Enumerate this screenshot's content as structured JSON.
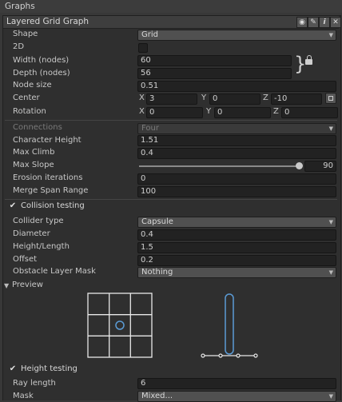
{
  "window": {
    "title": "Graphs"
  },
  "graph": {
    "title": "Layered Grid Graph"
  },
  "fields": {
    "shape": {
      "label": "Shape",
      "value": "Grid"
    },
    "twod": {
      "label": "2D"
    },
    "width": {
      "label": "Width (nodes)",
      "value": "60"
    },
    "depth": {
      "label": "Depth (nodes)",
      "value": "56"
    },
    "node_size": {
      "label": "Node size",
      "value": "0.51"
    },
    "center": {
      "label": "Center",
      "x": "3",
      "y": "0",
      "z": "-10"
    },
    "rotation": {
      "label": "Rotation",
      "x": "0",
      "y": "0",
      "z": "0"
    },
    "connections": {
      "label": "Connections",
      "value": "Four"
    },
    "char_height": {
      "label": "Character Height",
      "value": "1.51"
    },
    "max_climb": {
      "label": "Max Climb",
      "value": "0.4"
    },
    "max_slope": {
      "label": "Max Slope",
      "value": "90",
      "slider_fraction": 1.0
    },
    "erosion": {
      "label": "Erosion iterations",
      "value": "0"
    },
    "merge_span": {
      "label": "Merge Span Range",
      "value": "100"
    }
  },
  "collision": {
    "label": "Collision testing",
    "collider_type": {
      "label": "Collider type",
      "value": "Capsule"
    },
    "diameter": {
      "label": "Diameter",
      "value": "0.4"
    },
    "height_length": {
      "label": "Height/Length",
      "value": "1.5"
    },
    "offset": {
      "label": "Offset",
      "value": "0.2"
    },
    "mask": {
      "label": "Obstacle Layer Mask",
      "value": "Nothing"
    }
  },
  "preview": {
    "label": "Preview"
  },
  "height": {
    "label": "Height testing",
    "ray_length": {
      "label": "Ray length",
      "value": "6"
    },
    "mask": {
      "label": "Mask",
      "value": "Mixed..."
    }
  },
  "axes": {
    "x": "X",
    "y": "Y",
    "z": "Z"
  },
  "colors": {
    "accent": "#5b9bd5",
    "panel": "#2f2f2f",
    "field": "#222222"
  }
}
